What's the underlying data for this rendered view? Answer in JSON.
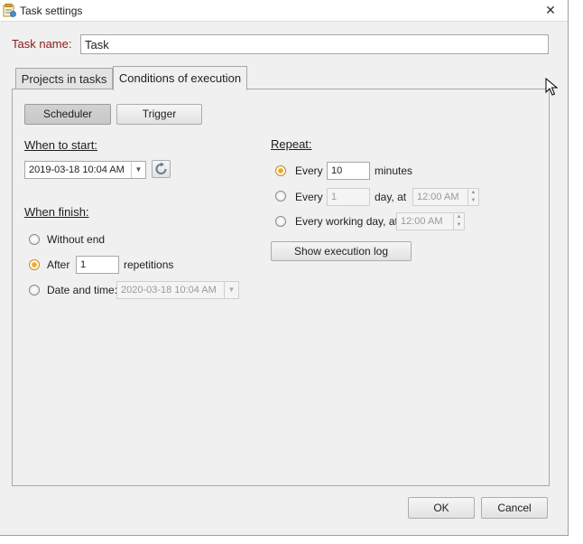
{
  "window": {
    "title": "Task settings"
  },
  "task_name": {
    "label": "Task name:",
    "value": "Task"
  },
  "tabs": [
    {
      "label": "Projects in tasks",
      "active": false
    },
    {
      "label": "Conditions of execution",
      "active": true
    }
  ],
  "mode_buttons": {
    "scheduler": "Scheduler",
    "trigger": "Trigger"
  },
  "when_to_start": {
    "heading": "When to start:",
    "datetime": "2019-03-18 10:04 AM"
  },
  "when_finish": {
    "heading": "When finish:",
    "without_end": "Without end",
    "after": "After",
    "after_count": "1",
    "repetitions": "repetitions",
    "date_and_time": "Date and time:",
    "end_datetime": "2020-03-18 10:04 AM"
  },
  "repeat": {
    "heading": "Repeat:",
    "every_label": "Every",
    "every_value": "10",
    "every_unit": "minutes",
    "every_day_label": "Every",
    "every_day_value": "1",
    "day_at": "day, at",
    "day_time": "12:00 AM",
    "working_day_label": "Every working day, at",
    "working_day_time": "12:00 AM",
    "show_log": "Show execution log"
  },
  "footer": {
    "ok": "OK",
    "cancel": "Cancel"
  },
  "colors": {
    "radio_checked": "#f5a623",
    "task_label": "#8b1a1a"
  }
}
